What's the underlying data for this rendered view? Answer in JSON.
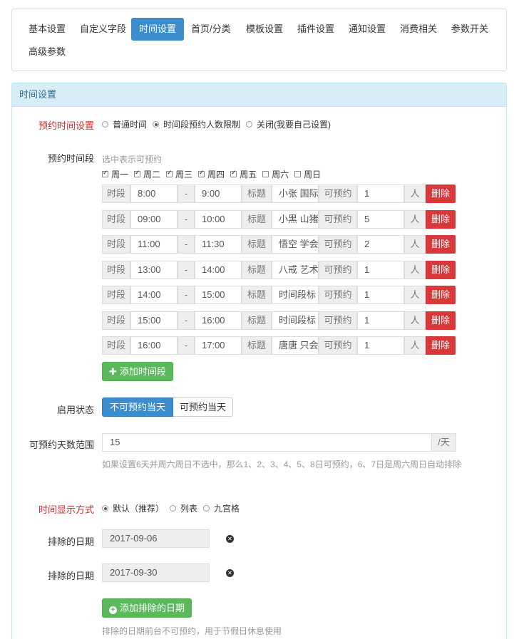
{
  "tabs": [
    {
      "label": "基本设置",
      "active": false
    },
    {
      "label": "自定义字段",
      "active": false
    },
    {
      "label": "时间设置",
      "active": true
    },
    {
      "label": "首页/分类",
      "active": false
    },
    {
      "label": "模板设置",
      "active": false
    },
    {
      "label": "插件设置",
      "active": false
    },
    {
      "label": "通知设置",
      "active": false
    },
    {
      "label": "消费相关",
      "active": false
    },
    {
      "label": "参数开关",
      "active": false
    },
    {
      "label": "高级参数",
      "active": false
    }
  ],
  "panel": {
    "title": "时间设置"
  },
  "booking_mode": {
    "label": "预约时间设置",
    "options": [
      "普通时间",
      "时间段预约人数限制",
      "关闭(我要自己设置)"
    ],
    "selected": 1
  },
  "time_slots": {
    "label": "预约时间段",
    "hint": "选中表示可预约",
    "days": [
      {
        "label": "周一",
        "checked": true
      },
      {
        "label": "周二",
        "checked": true
      },
      {
        "label": "周三",
        "checked": true
      },
      {
        "label": "周四",
        "checked": true
      },
      {
        "label": "周五",
        "checked": true
      },
      {
        "label": "周六",
        "checked": false
      },
      {
        "label": "周日",
        "checked": false
      }
    ],
    "slot_label": "时段",
    "dash": "-",
    "title_label": "标题",
    "capacity_label": "可预约",
    "unit": "人",
    "delete_label": "删除",
    "rows": [
      {
        "start": "8:00",
        "end": "9:00",
        "title": "小张 国际",
        "capacity": "1"
      },
      {
        "start": "09:00",
        "end": "10:00",
        "title": "小黑 山猪",
        "capacity": "5"
      },
      {
        "start": "11:00",
        "end": "11:30",
        "title": "悟空 学会",
        "capacity": "2"
      },
      {
        "start": "13:00",
        "end": "14:00",
        "title": "八戒 艺术",
        "capacity": "1"
      },
      {
        "start": "14:00",
        "end": "15:00",
        "title": "时间段标",
        "capacity": "1"
      },
      {
        "start": "15:00",
        "end": "16:00",
        "title": "时间段标",
        "capacity": "1"
      },
      {
        "start": "16:00",
        "end": "17:00",
        "title": "唐唐 只会",
        "capacity": "1"
      }
    ],
    "add_label": "添加时间段"
  },
  "enable_state": {
    "label": "启用状态",
    "options": [
      "不可预约当天",
      "可预约当天"
    ],
    "selected": 0
  },
  "day_range": {
    "label": "可预约天数范围",
    "value": "15",
    "unit": "/天",
    "help": "如果设置6天并周六周日不选中，那么1、2、3、4、5、8日可预约，6、7日是周六周日自动排除"
  },
  "display_mode": {
    "label": "时间显示方式",
    "options": [
      "默认（推荐）",
      "列表",
      "九宫格"
    ],
    "selected": 0
  },
  "excluded_dates": {
    "label": "排除的日期",
    "dates": [
      "2017-09-06",
      "2017-09-30"
    ],
    "add_label": "添加排除的日期",
    "help": "排除的日期前台不可预约，用于节假日休息使用"
  },
  "icons": {
    "remove": "remove-circle-icon",
    "plus": "plus-icon",
    "add_circle": "plus-circle-icon"
  },
  "colors": {
    "accent": "#3c8dce",
    "danger": "#d9383a",
    "success": "#5cb85c",
    "required": "#c9302c"
  }
}
